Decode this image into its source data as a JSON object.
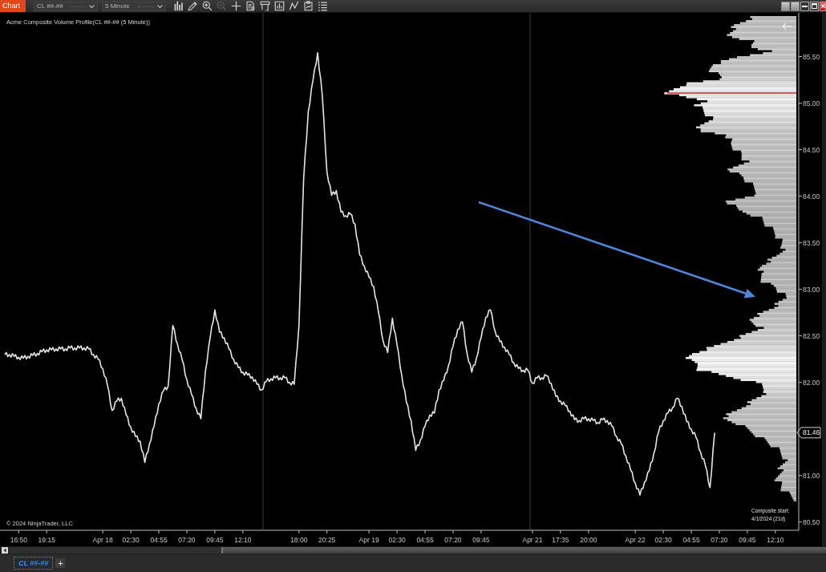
{
  "window": {
    "title": "Chart"
  },
  "toolbar": {
    "dropdowns": [
      {
        "value": "CL ##-##"
      },
      {
        "value": "5 Minute"
      }
    ],
    "tools": [
      {
        "kind": "bars",
        "disabled": false
      },
      {
        "kind": "pencil",
        "disabled": false
      },
      {
        "kind": "zoomin",
        "disabled": false
      },
      {
        "kind": "zoomout",
        "disabled": true
      },
      {
        "kind": "crosshair",
        "disabled": false
      },
      {
        "kind": "document",
        "disabled": false
      },
      {
        "kind": "panel",
        "disabled": false
      },
      {
        "kind": "indicators",
        "disabled": false
      },
      {
        "kind": "zigzag",
        "disabled": false
      },
      {
        "kind": "clipboard",
        "disabled": false
      },
      {
        "kind": "list",
        "disabled": false
      }
    ],
    "window_controls": [
      {
        "kind": "square"
      },
      {
        "kind": "square"
      },
      {
        "kind": "minimize"
      },
      {
        "kind": "maximize"
      },
      {
        "kind": "close"
      }
    ]
  },
  "chart": {
    "indicator_label": "Acme Composite Volume Profile(CL ##-## (5 Minute))",
    "copyright": "© 2024 NinjaTrader, LLC",
    "composite_start": {
      "label": "Composite start:",
      "date": "4/1/2024 (21d)"
    },
    "last_price": {
      "label": "81.46"
    },
    "chart_data": {
      "type": "line",
      "categories": [
        null,
        null,
        null,
        null,
        "16:50",
        null,
        null,
        null,
        null,
        null,
        "19:15",
        null,
        null,
        null,
        null,
        null,
        null,
        null,
        null,
        null,
        null,
        null,
        "Apr 18",
        null,
        null,
        null,
        null,
        null,
        "02:30",
        null,
        null,
        null,
        null,
        null,
        "04:55",
        null,
        null,
        null,
        null,
        null,
        "07:20",
        null,
        null,
        null,
        null,
        null,
        "09:45",
        null,
        null,
        null,
        null,
        null,
        "12:10",
        null,
        null,
        null,
        null,
        null,
        null,
        null,
        null,
        null,
        null,
        null,
        "18:00",
        null,
        null,
        null,
        null,
        null,
        "20:25",
        null,
        null,
        null,
        null,
        null,
        null,
        null,
        null,
        "Apr 19",
        null,
        null,
        null,
        null,
        null,
        "02:30",
        null,
        null,
        null,
        null,
        null,
        "04:55",
        null,
        null,
        null,
        null,
        null,
        "07:20",
        null,
        null,
        null,
        null,
        null,
        "09:45",
        null,
        null,
        null,
        null,
        null,
        null,
        null,
        null,
        null,
        null,
        "Apr 21",
        null,
        null,
        null,
        null,
        null,
        "17:35",
        null,
        null,
        null,
        null,
        null,
        "20:00",
        null,
        null,
        null,
        null,
        null,
        null,
        null,
        null,
        null,
        "Apr 22",
        null,
        null,
        null,
        null,
        null,
        "02:30",
        null,
        null,
        null,
        null,
        null,
        "04:55",
        null,
        null,
        null,
        null,
        null,
        "07:20",
        null,
        null,
        null,
        null,
        null,
        "09:45",
        null,
        null,
        null,
        null,
        null,
        "12:10",
        null,
        null,
        null,
        null
      ],
      "series": [
        {
          "color": "#e6e6e6",
          "values": [
            null,
            82.3,
            82.3,
            82.28,
            82.27,
            82.26,
            82.28,
            82.29,
            82.31,
            82.33,
            82.35,
            82.35,
            82.36,
            82.36,
            82.36,
            82.37,
            82.37,
            82.37,
            82.37,
            82.36,
            82.3,
            82.25,
            82.15,
            81.97,
            81.7,
            81.8,
            81.83,
            81.65,
            81.52,
            81.42,
            81.37,
            81.14,
            81.34,
            81.53,
            81.77,
            81.91,
            81.96,
            82.61,
            82.41,
            82.24,
            82.03,
            81.87,
            81.72,
            81.61,
            82.13,
            82.48,
            82.78,
            82.54,
            82.48,
            82.36,
            82.25,
            82.16,
            82.11,
            82.08,
            82.06,
            81.98,
            81.92,
            82.01,
            82.04,
            82.05,
            82.05,
            82.05,
            82.0,
            81.98,
            82.61,
            84.18,
            84.91,
            85.24,
            85.54,
            85.08,
            84.26,
            84.01,
            84.06,
            83.83,
            83.79,
            83.81,
            83.7,
            83.37,
            83.25,
            83.13,
            83.03,
            82.76,
            82.45,
            82.32,
            82.69,
            82.4,
            82.08,
            81.79,
            81.59,
            81.27,
            81.38,
            81.53,
            81.65,
            81.67,
            81.92,
            82.02,
            82.18,
            82.39,
            82.57,
            82.65,
            82.31,
            82.11,
            82.26,
            82.48,
            82.7,
            82.78,
            82.55,
            82.44,
            82.38,
            82.3,
            82.21,
            82.15,
            82.13,
            82.13,
            81.99,
            82.05,
            82.05,
            82.07,
            81.99,
            81.85,
            81.8,
            81.75,
            81.69,
            81.6,
            81.59,
            81.61,
            81.61,
            81.59,
            81.57,
            81.6,
            81.59,
            81.53,
            81.42,
            81.34,
            81.21,
            81.06,
            80.92,
            80.79,
            80.93,
            81.05,
            81.24,
            81.47,
            81.59,
            81.67,
            81.73,
            81.83,
            81.74,
            81.58,
            81.5,
            81.41,
            81.25,
            81.11,
            80.87,
            81.46,
            null,
            null,
            null,
            null,
            null,
            null,
            null,
            null,
            null,
            null,
            null,
            null,
            null,
            null,
            null,
            null,
            null
          ]
        }
      ],
      "ylim": [
        80.42,
        85.97
      ],
      "yticks": [
        {
          "value": 85.5,
          "label": "85.50"
        },
        {
          "value": 85,
          "label": "85.00"
        },
        {
          "value": 84.5,
          "label": "84.50"
        },
        {
          "value": 84,
          "label": "84.00"
        },
        {
          "value": 83.5,
          "label": "83.50"
        },
        {
          "value": 83,
          "label": "83.00"
        },
        {
          "value": 82.5,
          "label": "82.50"
        },
        {
          "value": 82,
          "label": "82.00"
        },
        {
          "value": 81,
          "label": "81.00"
        },
        {
          "value": 80.5,
          "label": "80.50"
        }
      ]
    }
  },
  "tabs": [
    {
      "label": "CL ##-##",
      "selected": true
    }
  ],
  "add_tab": {
    "label": "+"
  }
}
